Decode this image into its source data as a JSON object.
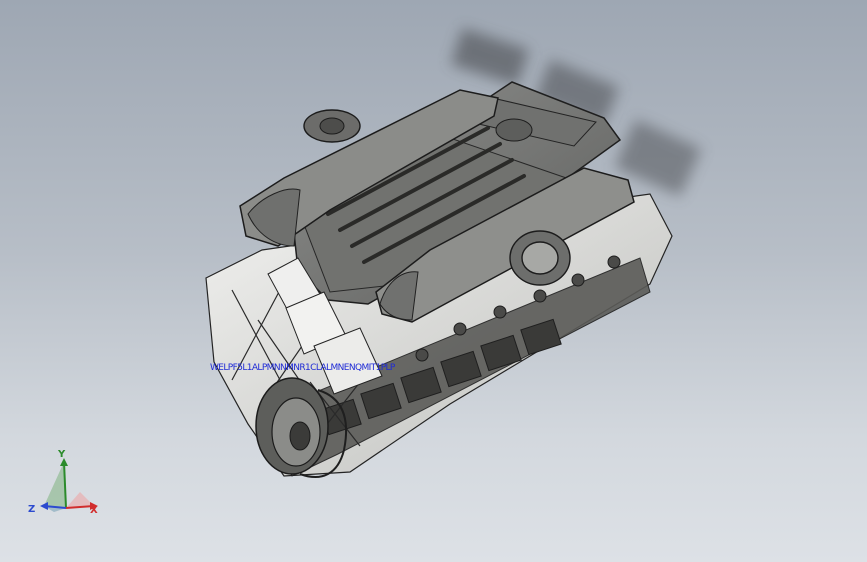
{
  "view": {
    "background_top": "#9ea7b3",
    "background_bottom": "#dde1e6"
  },
  "model": {
    "name": "engine-assembly"
  },
  "overlay_text": "WELPF5L1ALPMNNMNR1CLALMNENQMIT1PLP",
  "triad": {
    "x_label": "X",
    "y_label": "Y",
    "z_label": "Z",
    "x_color": "#d12d2d",
    "y_color": "#2b8b2b",
    "z_color": "#2c4bcf"
  }
}
